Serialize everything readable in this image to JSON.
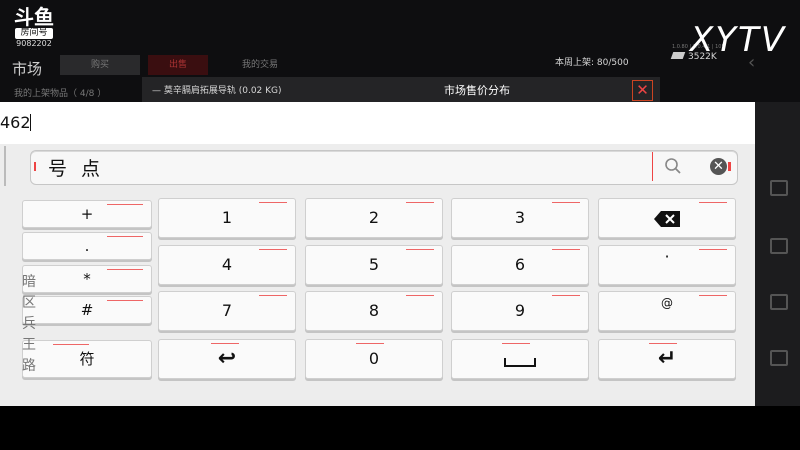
{
  "stream": {
    "platform_brand": "斗鱼",
    "room_tag": "房间号",
    "room_id": "9082202",
    "watermark": "XYTV"
  },
  "game": {
    "market_title": "市场",
    "tabs": [
      "购买",
      "出售",
      "我的交易"
    ],
    "sub_label": "我的上架物品（ 4/8 ）",
    "weekly_listing_label": "本周上架:",
    "weekly_listing_value": "80/500",
    "silver": "3522K",
    "small_stats": "1.0.80 | 2.0.4.1 | 105"
  },
  "modal": {
    "item_name": "— 莫辛膈肩拓展导轨 (0.02 KG)",
    "title": "市场售价分布",
    "close_label": "✕"
  },
  "input": {
    "value": "462"
  },
  "keyboard": {
    "candidate_text": "号点",
    "clear_label": "✕",
    "symbol_keys": [
      "+",
      ".",
      "*",
      "#",
      "符"
    ],
    "side_vertical_text": "暗区兵王路",
    "number_rows": [
      [
        "1",
        "2",
        "3",
        "⌫"
      ],
      [
        "4",
        "5",
        "6",
        "·"
      ],
      [
        "7",
        "8",
        "9",
        "@"
      ],
      [
        "↩",
        "0",
        "␣",
        "↵"
      ]
    ],
    "accent_color": "#e44444"
  }
}
